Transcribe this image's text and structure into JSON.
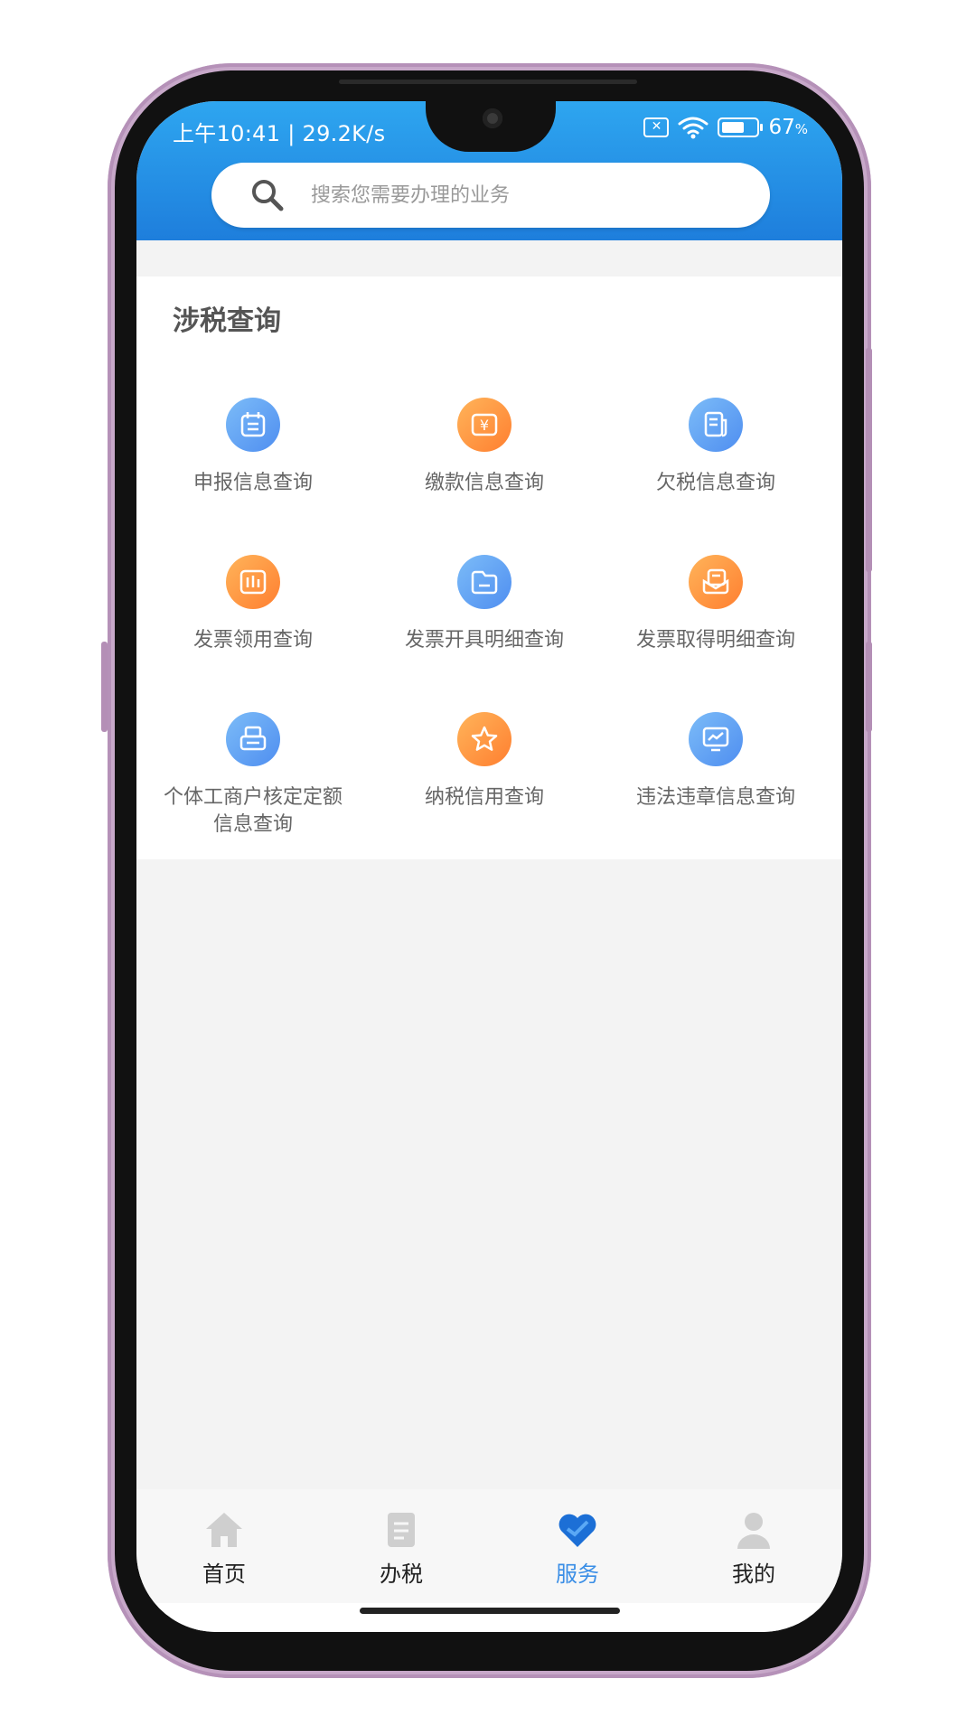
{
  "status_bar": {
    "time_speed": "上午10:41 | 29.2K/s",
    "battery": "67",
    "battery_unit": "%",
    "battery_level": 0.67,
    "icons": [
      "sim-x-icon",
      "wifi-icon",
      "battery-icon"
    ]
  },
  "search": {
    "placeholder": "搜索您需要办理的业务"
  },
  "section": {
    "title": "涉税查询"
  },
  "grid_items": [
    {
      "label": "申报信息查询",
      "icon": "calendar-icon",
      "color": "#5a9cf2"
    },
    {
      "label": "缴款信息查询",
      "icon": "yuan-cycle-icon",
      "color": "#ff8a3a"
    },
    {
      "label": "欠税信息查询",
      "icon": "document-icon",
      "color": "#5a9cf2"
    },
    {
      "label": "发票领用查询",
      "icon": "bar-chart-icon",
      "color": "#ff8a3a"
    },
    {
      "label": "发票开具明细查询",
      "icon": "folder-icon",
      "color": "#5a9cf2"
    },
    {
      "label": "发票取得明细查询",
      "icon": "inbox-icon",
      "color": "#ff8a3a"
    },
    {
      "label": "个体工商户核定定额",
      "label2": "信息查询",
      "icon": "printer-icon",
      "color": "#5a9cf2"
    },
    {
      "label": "纳税信用查询",
      "icon": "star-icon",
      "color": "#ff8a3a"
    },
    {
      "label": "违法违章信息查询",
      "icon": "monitor-chart-icon",
      "color": "#5a9cf2"
    }
  ],
  "bottom_nav": [
    {
      "label": "首页",
      "icon": "home-icon",
      "active": false
    },
    {
      "label": "办税",
      "icon": "document-list-icon",
      "active": false
    },
    {
      "label": "服务",
      "icon": "heart-icon",
      "active": true
    },
    {
      "label": "我的",
      "icon": "person-icon",
      "active": false
    }
  ],
  "colors": {
    "header_top": "#2ea6f0",
    "header_bottom": "#1e7edc",
    "accent_active": "#3a8ee6",
    "icon_blue": "#5a9cf2",
    "icon_orange": "#ff8a3a"
  }
}
